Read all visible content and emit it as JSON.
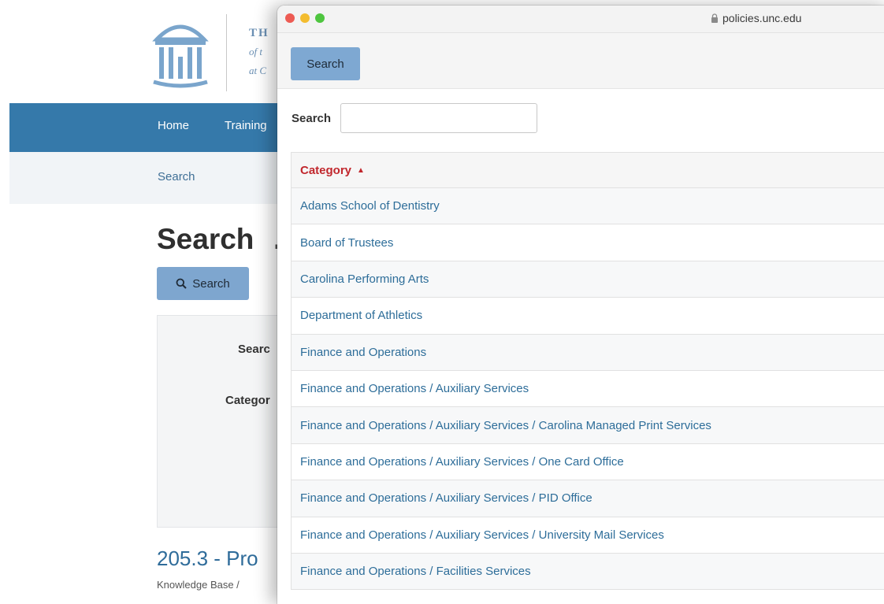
{
  "background": {
    "logo_text": {
      "line1": "TH",
      "line2": "of t",
      "line3": "at C"
    },
    "nav": {
      "home": "Home",
      "training": "Training"
    },
    "breadcrumb": "Search",
    "heading": "Search",
    "heading_cut": ".",
    "search_button": "Search",
    "form": {
      "search_label": "Searc",
      "category_label": "Categor"
    },
    "result": {
      "title": "205.3 - Pro",
      "meta": "Knowledge Base /"
    }
  },
  "popup": {
    "url": "policies.unc.edu",
    "toolbar": {
      "search_button": "Search"
    },
    "search": {
      "label": "Search",
      "value": "",
      "placeholder": ""
    },
    "table": {
      "header": "Category",
      "sort": "ascending",
      "rows": [
        "Adams School of Dentistry",
        "Board of Trustees",
        "Carolina Performing Arts",
        "Department of Athletics",
        "Finance and Operations",
        "Finance and Operations / Auxiliary Services",
        "Finance and Operations / Auxiliary Services / Carolina Managed Print Services",
        "Finance and Operations / Auxiliary Services / One Card Office",
        "Finance and Operations / Auxiliary Services / PID Office",
        "Finance and Operations / Auxiliary Services / University Mail Services",
        "Finance and Operations / Facilities Services"
      ]
    }
  },
  "colors": {
    "nav_blue": "#3579aa",
    "link_blue": "#2d6d99",
    "sort_red": "#c1272d",
    "button_blue": "#7ea8d2"
  },
  "icons": [
    "search-icon",
    "lock-icon",
    "old-well-logo",
    "sort-asc-icon"
  ]
}
